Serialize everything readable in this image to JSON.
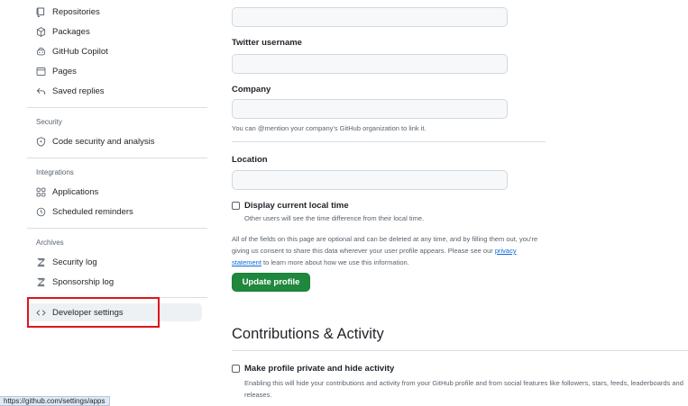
{
  "sidebar": {
    "items": [
      {
        "label": "Repositories",
        "icon": "repo-icon"
      },
      {
        "label": "Packages",
        "icon": "package-icon"
      },
      {
        "label": "GitHub Copilot",
        "icon": "copilot-icon"
      },
      {
        "label": "Pages",
        "icon": "browser-icon"
      },
      {
        "label": "Saved replies",
        "icon": "reply-icon"
      }
    ],
    "security": {
      "heading": "Security",
      "items": [
        {
          "label": "Code security and analysis",
          "icon": "shield-lock-icon"
        }
      ]
    },
    "integrations": {
      "heading": "Integrations",
      "items": [
        {
          "label": "Applications",
          "icon": "apps-icon"
        },
        {
          "label": "Scheduled reminders",
          "icon": "clock-icon"
        }
      ]
    },
    "archives": {
      "heading": "Archives",
      "items": [
        {
          "label": "Security log",
          "icon": "log-icon"
        },
        {
          "label": "Sponsorship log",
          "icon": "log-icon"
        }
      ]
    },
    "developer": {
      "label": "Developer settings",
      "icon": "code-icon"
    }
  },
  "form": {
    "twitter_label": "Twitter username",
    "company_label": "Company",
    "company_hint": "You can @mention your company's GitHub organization to link it.",
    "location_label": "Location",
    "local_time_label": "Display current local time",
    "local_time_hint": "Other users will see the time difference from their local time.",
    "optional_text_before": "All of the fields on this page are optional and can be deleted at any time, and by filling them out, you're giving us consent to share this data wherever your user profile appears. Please see our ",
    "privacy_link": "privacy statement",
    "optional_text_after": " to learn more about how we use this information.",
    "update_button": "Update profile"
  },
  "contributions": {
    "heading": "Contributions & Activity",
    "private_label": "Make profile private and hide activity",
    "private_hint": "Enabling this will hide your contributions and activity from your GitHub profile and from social features like followers, stars, feeds, leaderboards and releases."
  },
  "status_bar": {
    "url": "https://github.com/settings/apps"
  },
  "colors": {
    "accent_green": "#1f883d",
    "link_blue": "#0969da",
    "highlight_red": "#e0141b"
  }
}
